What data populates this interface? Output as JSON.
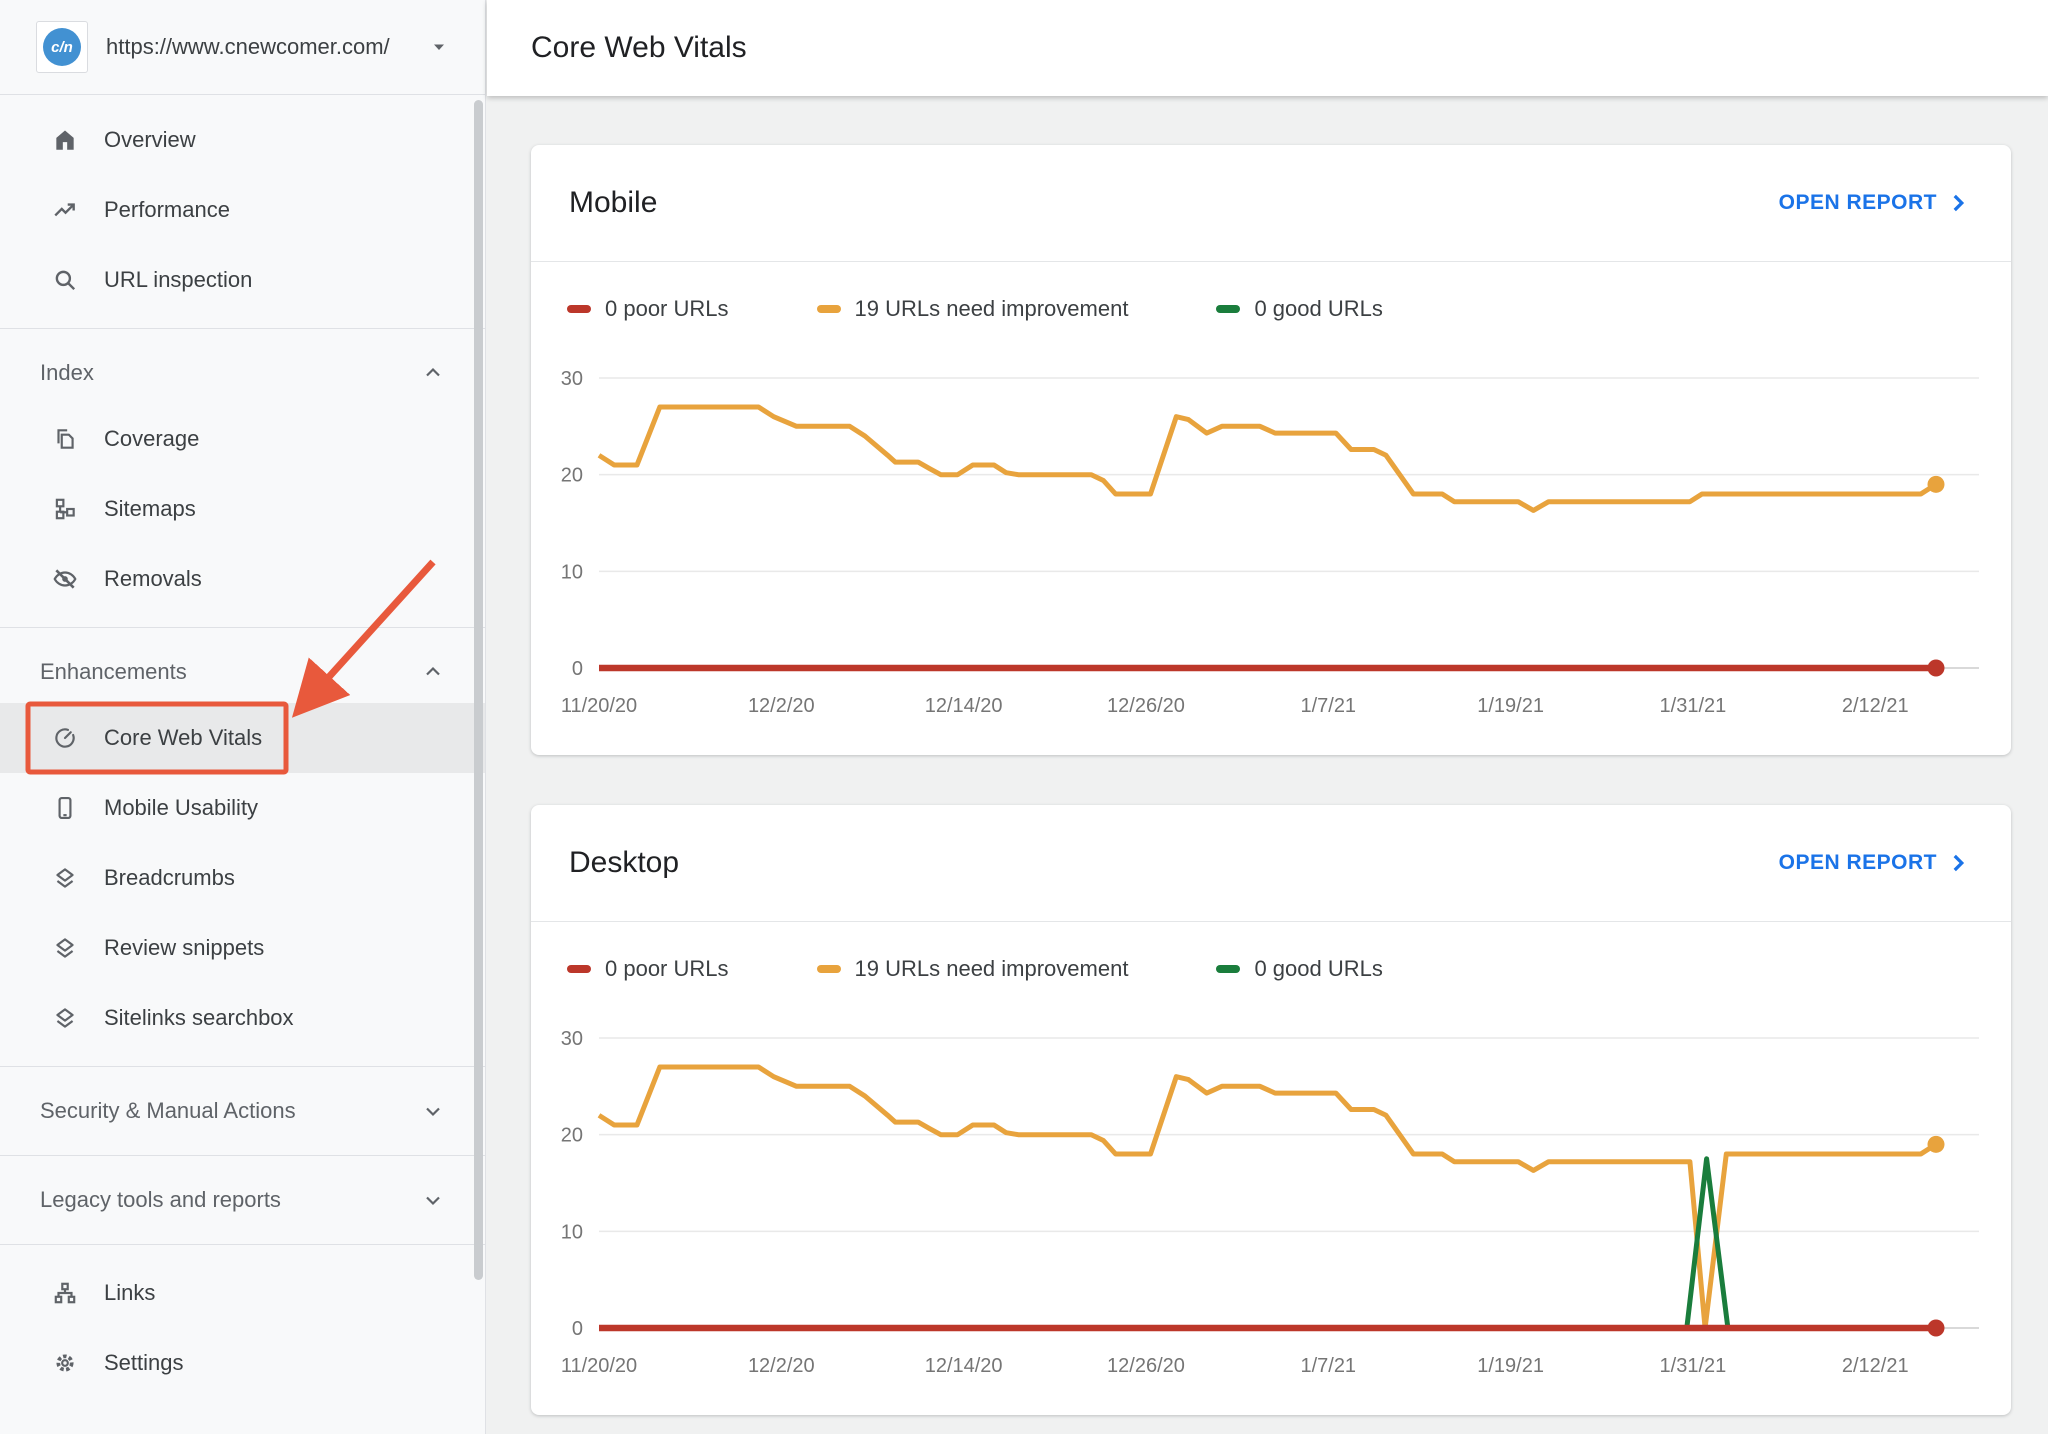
{
  "page": {
    "title": "Core Web Vitals"
  },
  "property": {
    "url": "https://www.cnewcomer.com/",
    "favicon_text": "c/n"
  },
  "colors": {
    "accent_blue": "#1a73e8",
    "annotation": "#e8593c",
    "poor": "#bc372a",
    "needs_improvement": "#e8a33d",
    "good": "#1a7d3c"
  },
  "sidebar": {
    "primary": [
      {
        "id": "overview",
        "label": "Overview",
        "icon": "home-icon"
      },
      {
        "id": "performance",
        "label": "Performance",
        "icon": "trending-up-icon"
      },
      {
        "id": "url-inspection",
        "label": "URL inspection",
        "icon": "search-icon"
      }
    ],
    "sections": [
      {
        "id": "index",
        "label": "Index",
        "state": "expanded",
        "items": [
          {
            "id": "coverage",
            "label": "Coverage",
            "icon": "pages-icon"
          },
          {
            "id": "sitemaps",
            "label": "Sitemaps",
            "icon": "sitemap-icon"
          },
          {
            "id": "removals",
            "label": "Removals",
            "icon": "eye-off-icon"
          }
        ]
      },
      {
        "id": "enhancements",
        "label": "Enhancements",
        "state": "expanded",
        "items": [
          {
            "id": "core-web-vitals",
            "label": "Core Web Vitals",
            "icon": "gauge-icon",
            "selected": true,
            "annotated": true
          },
          {
            "id": "mobile-usability",
            "label": "Mobile Usability",
            "icon": "smartphone-icon"
          },
          {
            "id": "breadcrumbs",
            "label": "Breadcrumbs",
            "icon": "rich-result-icon"
          },
          {
            "id": "review-snippets",
            "label": "Review snippets",
            "icon": "rich-result-icon"
          },
          {
            "id": "sitelinks-searchbox",
            "label": "Sitelinks searchbox",
            "icon": "rich-result-icon"
          }
        ]
      },
      {
        "id": "security-manual-actions",
        "label": "Security & Manual Actions",
        "state": "collapsed",
        "items": []
      },
      {
        "id": "legacy-tools",
        "label": "Legacy tools and reports",
        "state": "collapsed",
        "items": []
      }
    ],
    "footer": [
      {
        "id": "links",
        "label": "Links",
        "icon": "links-icon"
      },
      {
        "id": "settings",
        "label": "Settings",
        "icon": "gear-icon"
      }
    ]
  },
  "annotation": {
    "type": "highlight-box-and-arrow",
    "target": "core-web-vitals",
    "color": "#e8593c"
  },
  "cards": [
    {
      "id": "mobile",
      "title": "Mobile",
      "open_report_label": "OPEN REPORT"
    },
    {
      "id": "desktop",
      "title": "Desktop",
      "open_report_label": "OPEN REPORT"
    }
  ],
  "legend": [
    {
      "label": "0 poor URLs",
      "color": "#bc372a"
    },
    {
      "label": "19 URLs need improvement",
      "color": "#e8a33d"
    },
    {
      "label": "0 good URLs",
      "color": "#1a7d3c"
    }
  ],
  "chart_data": [
    {
      "id": "mobile",
      "type": "line",
      "title": "Mobile",
      "x_unit": "days since 11/20/20",
      "x_range_days": [
        0,
        88
      ],
      "ylim": [
        0,
        30
      ],
      "y_ticks": [
        0,
        10,
        20,
        30
      ],
      "grid": true,
      "x_ticks": [
        {
          "day": 0,
          "label": "11/20/20"
        },
        {
          "day": 12,
          "label": "12/2/20"
        },
        {
          "day": 24,
          "label": "12/14/20"
        },
        {
          "day": 36,
          "label": "12/26/20"
        },
        {
          "day": 48,
          "label": "1/7/21"
        },
        {
          "day": 60,
          "label": "1/19/21"
        },
        {
          "day": 72,
          "label": "1/31/21"
        },
        {
          "day": 84,
          "label": "2/12/21"
        }
      ],
      "series": [
        {
          "name": "19 URLs need improvement",
          "color": "#e8a33d",
          "width": 5,
          "end_dot": true,
          "points": [
            [
              0,
              22
            ],
            [
              1,
              21
            ],
            [
              2.5,
              21
            ],
            [
              4,
              27
            ],
            [
              10.5,
              27
            ],
            [
              11.5,
              26
            ],
            [
              13,
              25
            ],
            [
              16.5,
              25
            ],
            [
              17.5,
              24
            ],
            [
              19,
              22
            ],
            [
              19.5,
              21.3
            ],
            [
              21,
              21.3
            ],
            [
              21.8,
              20.6
            ],
            [
              22.5,
              20
            ],
            [
              23.6,
              20
            ],
            [
              24.6,
              21
            ],
            [
              26,
              21
            ],
            [
              26.8,
              20.2
            ],
            [
              27.6,
              20
            ],
            [
              32.4,
              20
            ],
            [
              33.2,
              19.4
            ],
            [
              34,
              18
            ],
            [
              36.3,
              18
            ],
            [
              38,
              26
            ],
            [
              38.8,
              25.7
            ],
            [
              40,
              24.3
            ],
            [
              41,
              25
            ],
            [
              43.5,
              25
            ],
            [
              44.5,
              24.3
            ],
            [
              48.5,
              24.3
            ],
            [
              49.5,
              22.6
            ],
            [
              51,
              22.6
            ],
            [
              51.8,
              22
            ],
            [
              53.6,
              18
            ],
            [
              55.5,
              18
            ],
            [
              56.3,
              17.2
            ],
            [
              60.5,
              17.2
            ],
            [
              61.5,
              16.3
            ],
            [
              62.5,
              17.2
            ],
            [
              71.8,
              17.2
            ],
            [
              72.6,
              18
            ],
            [
              87,
              18
            ],
            [
              88,
              19
            ]
          ]
        },
        {
          "name": "0 good URLs",
          "color": "#1a7d3c",
          "width": 5,
          "end_dot": false,
          "points": [
            [
              0,
              0
            ],
            [
              88,
              0
            ]
          ]
        },
        {
          "name": "0 poor URLs",
          "color": "#bc372a",
          "width": 6.5,
          "end_dot": true,
          "points": [
            [
              0,
              0
            ],
            [
              88,
              0
            ]
          ]
        }
      ]
    },
    {
      "id": "desktop",
      "type": "line",
      "title": "Desktop",
      "x_unit": "days since 11/20/20",
      "x_range_days": [
        0,
        88
      ],
      "ylim": [
        0,
        30
      ],
      "y_ticks": [
        0,
        10,
        20,
        30
      ],
      "grid": true,
      "x_ticks": [
        {
          "day": 0,
          "label": "11/20/20"
        },
        {
          "day": 12,
          "label": "12/2/20"
        },
        {
          "day": 24,
          "label": "12/14/20"
        },
        {
          "day": 36,
          "label": "12/26/20"
        },
        {
          "day": 48,
          "label": "1/7/21"
        },
        {
          "day": 60,
          "label": "1/19/21"
        },
        {
          "day": 72,
          "label": "1/31/21"
        },
        {
          "day": 84,
          "label": "2/12/21"
        }
      ],
      "series": [
        {
          "name": "19 URLs need improvement",
          "color": "#e8a33d",
          "width": 5,
          "end_dot": true,
          "points": [
            [
              0,
              22
            ],
            [
              1,
              21
            ],
            [
              2.5,
              21
            ],
            [
              4,
              27
            ],
            [
              10.5,
              27
            ],
            [
              11.5,
              26
            ],
            [
              13,
              25
            ],
            [
              16.5,
              25
            ],
            [
              17.5,
              24
            ],
            [
              19,
              22
            ],
            [
              19.5,
              21.3
            ],
            [
              21,
              21.3
            ],
            [
              21.8,
              20.6
            ],
            [
              22.5,
              20
            ],
            [
              23.6,
              20
            ],
            [
              24.6,
              21
            ],
            [
              26,
              21
            ],
            [
              26.8,
              20.2
            ],
            [
              27.6,
              20
            ],
            [
              32.4,
              20
            ],
            [
              33.2,
              19.4
            ],
            [
              34,
              18
            ],
            [
              36.3,
              18
            ],
            [
              38,
              26
            ],
            [
              38.8,
              25.7
            ],
            [
              40,
              24.3
            ],
            [
              41,
              25
            ],
            [
              43.5,
              25
            ],
            [
              44.5,
              24.3
            ],
            [
              48.5,
              24.3
            ],
            [
              49.5,
              22.6
            ],
            [
              51,
              22.6
            ],
            [
              51.8,
              22
            ],
            [
              53.6,
              18
            ],
            [
              55.5,
              18
            ],
            [
              56.3,
              17.2
            ],
            [
              60.5,
              17.2
            ],
            [
              61.5,
              16.3
            ],
            [
              62.5,
              17.2
            ],
            [
              71.8,
              17.2
            ],
            [
              72.8,
              0
            ],
            [
              74.2,
              18
            ],
            [
              87,
              18
            ],
            [
              88,
              19
            ]
          ]
        },
        {
          "name": "0 good URLs",
          "color": "#1a7d3c",
          "width": 5,
          "end_dot": false,
          "points": [
            [
              0,
              0
            ],
            [
              71.6,
              0
            ],
            [
              72.9,
              17.5
            ],
            [
              74.3,
              0
            ],
            [
              88,
              0
            ]
          ]
        },
        {
          "name": "0 poor URLs",
          "color": "#bc372a",
          "width": 6.5,
          "end_dot": true,
          "points": [
            [
              0,
              0
            ],
            [
              88,
              0
            ]
          ]
        }
      ]
    }
  ]
}
